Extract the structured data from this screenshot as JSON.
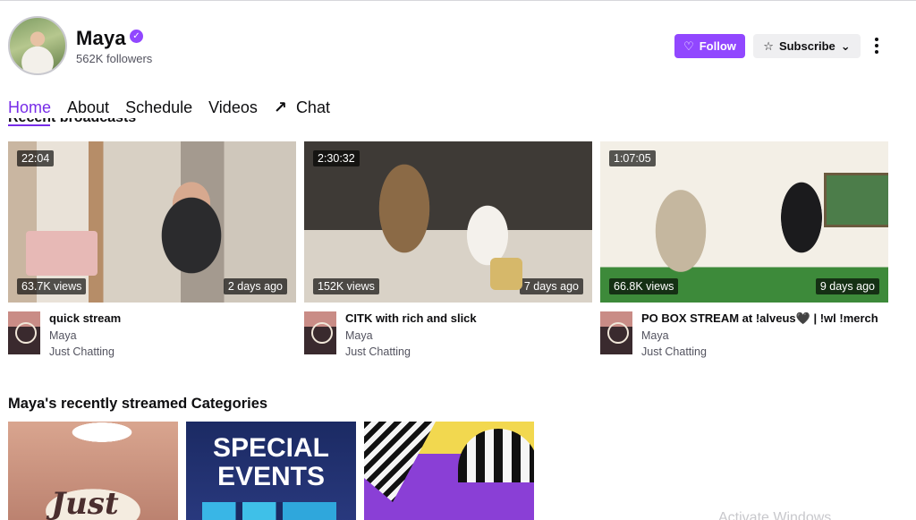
{
  "channel": {
    "name": "Maya",
    "verified_icon": "verified-badge-icon",
    "followers": "562K followers"
  },
  "actions": {
    "follow_label": "Follow",
    "subscribe_label": "Subscribe",
    "accent": "#9147ff"
  },
  "tabs": [
    {
      "label": "Home",
      "active": true
    },
    {
      "label": "About"
    },
    {
      "label": "Schedule"
    },
    {
      "label": "Videos"
    },
    {
      "label": "Chat",
      "icon": "arrow-up-right-icon"
    }
  ],
  "recent": {
    "heading": "Recent broadcasts",
    "videos": [
      {
        "duration": "22:04",
        "views": "63.7K views",
        "ago": "2 days ago",
        "title": "quick stream",
        "channel": "Maya",
        "category": "Just Chatting"
      },
      {
        "duration": "2:30:32",
        "views": "152K views",
        "ago": "7 days ago",
        "title": "CITK with rich and slick",
        "channel": "Maya",
        "category": "Just Chatting"
      },
      {
        "duration": "1:07:05",
        "views": "66.8K views",
        "ago": "9 days ago",
        "title": "PO BOX STREAM at !alveus🖤 | !wl !merch",
        "channel": "Maya",
        "category": "Just Chatting"
      }
    ]
  },
  "categories": {
    "heading": "Maya's recently streamed Categories",
    "tiles": [
      {
        "art_text": "Just"
      },
      {
        "art_text_1": "SPECIAL",
        "art_text_2": "EVENTS"
      },
      {}
    ]
  },
  "overlay": {
    "watermark": "Activate Windows"
  }
}
